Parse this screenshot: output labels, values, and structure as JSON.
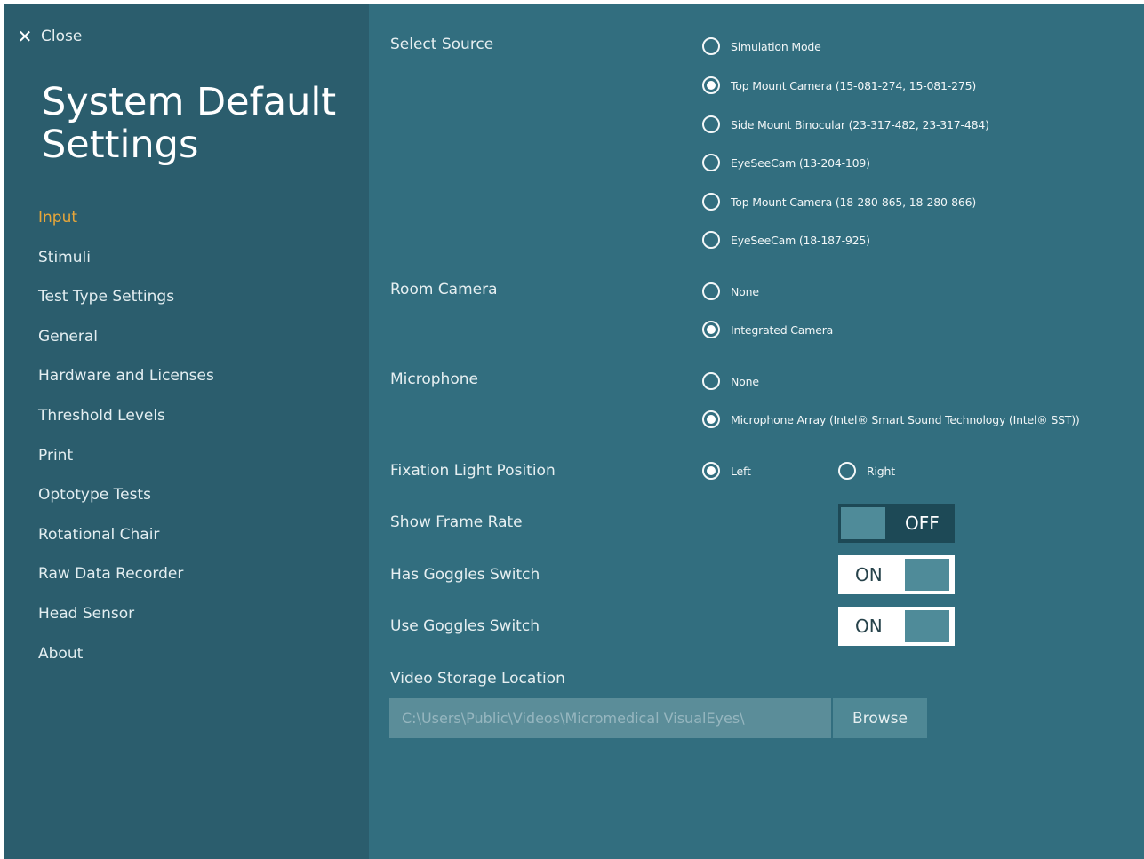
{
  "sidebar": {
    "close_icon": "close-icon",
    "close_glyph": "✕",
    "close_label": "Close",
    "title": "System Default Settings",
    "items": [
      {
        "label": "Input",
        "active": true
      },
      {
        "label": "Stimuli"
      },
      {
        "label": "Test Type Settings"
      },
      {
        "label": "General"
      },
      {
        "label": "Hardware and Licenses"
      },
      {
        "label": "Threshold Levels"
      },
      {
        "label": "Print"
      },
      {
        "label": "Optotype Tests"
      },
      {
        "label": "Rotational Chair"
      },
      {
        "label": "Raw Data Recorder"
      },
      {
        "label": "Head Sensor"
      },
      {
        "label": "About"
      }
    ]
  },
  "colors": {
    "sidebar_bg": "#2b5d6d",
    "main_bg": "#326e7f",
    "active_nav": "#e7a63a"
  },
  "select_source": {
    "label": "Select Source",
    "options": [
      {
        "label": "Simulation Mode",
        "checked": false
      },
      {
        "label": "Top Mount Camera   (15-081-274, 15-081-275)",
        "checked": true
      },
      {
        "label": "Side Mount Binocular   (23-317-482, 23-317-484)",
        "checked": false
      },
      {
        "label": "EyeSeeCam   (13-204-109)",
        "checked": false
      },
      {
        "label": "Top Mount Camera   (18-280-865, 18-280-866)",
        "checked": false
      },
      {
        "label": "EyeSeeCam   (18-187-925)",
        "checked": false
      }
    ]
  },
  "room_camera": {
    "label": "Room Camera",
    "options": [
      {
        "label": "None",
        "checked": false
      },
      {
        "label": "Integrated Camera",
        "checked": true
      }
    ]
  },
  "microphone": {
    "label": "Microphone",
    "options": [
      {
        "label": "None",
        "checked": false
      },
      {
        "label": "Microphone Array (Intel® Smart Sound Technology (Intel® SST))",
        "checked": true
      }
    ]
  },
  "fixation_light": {
    "label": "Fixation Light Position",
    "options": [
      {
        "label": "Left",
        "checked": true
      },
      {
        "label": "Right",
        "checked": false
      }
    ]
  },
  "show_frame_rate": {
    "label": "Show Frame Rate",
    "state": "OFF"
  },
  "has_goggles_switch": {
    "label": "Has Goggles Switch",
    "state": "ON"
  },
  "use_goggles_switch": {
    "label": "Use Goggles Switch",
    "state": "ON"
  },
  "video_storage": {
    "label": "Video Storage Location",
    "placeholder": "C:\\Users\\Public\\Videos\\Micromedical VisualEyes\\",
    "browse_label": "Browse"
  }
}
